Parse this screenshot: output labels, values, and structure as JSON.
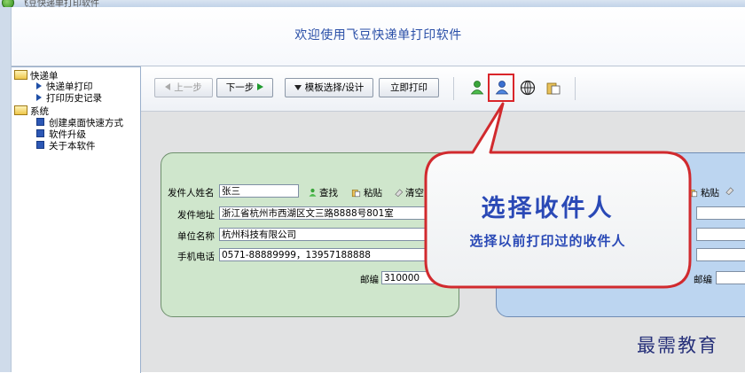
{
  "window": {
    "title": "飞豆快递单打印软件"
  },
  "header": {
    "welcome": "欢迎使用飞豆快递单打印软件"
  },
  "sidebar": {
    "groups": [
      {
        "label": "快递单",
        "icon": "folder-icon",
        "items": [
          {
            "label": "快递单打印",
            "icon": "arrow-icon"
          },
          {
            "label": "打印历史记录",
            "icon": "arrow-icon"
          }
        ]
      },
      {
        "label": "系统",
        "icon": "folder-icon",
        "items": [
          {
            "label": "创建桌面快速方式",
            "icon": "square-icon"
          },
          {
            "label": "软件升级",
            "icon": "square-icon"
          },
          {
            "label": "关于本软件",
            "icon": "square-icon"
          }
        ]
      }
    ]
  },
  "toolbar": {
    "prev": "上一步",
    "next": "下一步",
    "template": "模板选择/设计",
    "print": "立即打印",
    "icons": [
      "sender-user-icon",
      "recipient-user-icon",
      "globe-icon",
      "paste-icon"
    ]
  },
  "sender": {
    "name_label": "发件人姓名",
    "name_value": "张三",
    "find": "查找",
    "paste": "粘贴",
    "clear": "清空",
    "address_label": "发件地址",
    "address_value": "浙江省杭州市西湖区文三路8888号801室",
    "company_label": "单位名称",
    "company_value": "杭州科技有限公司",
    "phone_label": "手机电话",
    "phone_value": "0571-88889999，13957188888",
    "zip_label": "邮编",
    "zip_value": "310000"
  },
  "recipient": {
    "paste": "粘贴",
    "zip_label": "邮编"
  },
  "callout": {
    "title": "选择收件人",
    "subtitle": "选择以前打印过的收件人"
  },
  "watermark": "最需教育",
  "colors": {
    "header_text": "#2b50a8",
    "sender_panel": "#cfe6cc",
    "recipient_panel": "#bcd5f0",
    "highlight": "#d9252a",
    "callout_text": "#2a49b6"
  }
}
